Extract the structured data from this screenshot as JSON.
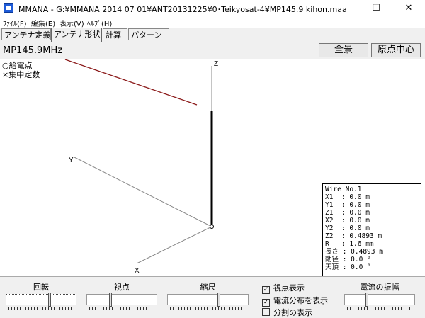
{
  "window": {
    "title": "MMANA - G:¥MMANA 2014 07 01¥ANT20131225¥0･Teikyosat-4¥MP145.9 kihon.maa",
    "minimize": "—",
    "maximize": "☐",
    "close": "✕"
  },
  "menu": [
    "ﾌｧｲﾙ(F)",
    "編集(E)",
    "表示(V)",
    "ﾍﾙﾌﾟ(H)"
  ],
  "tabs": [
    "アンテナ定義",
    "アンテナ形状",
    "計算",
    "パターン"
  ],
  "active_tab": 1,
  "top": {
    "model_name": "MP145.9MHz",
    "btn_full": "全景",
    "btn_center": "原点中心"
  },
  "legend": {
    "feed": "○給電点",
    "load": "×集中定数"
  },
  "axes": {
    "x": "X",
    "y": "Y",
    "z": "Z"
  },
  "wire_info": [
    "Wire No.1",
    "X1  : 0.0 m",
    "Y1  : 0.0 m",
    "Z1  : 0.0 m",
    "X2  : 0.0 m",
    "Y2  : 0.0 m",
    "Z2  : 0.4893 m",
    "R   : 1.6 mm",
    "長さ : 0.4893 m",
    "動径 : 0.0 °",
    "天頂 : 0.0 °"
  ],
  "controls": {
    "rotate": "回転",
    "viewpoint": "視点",
    "scale": "縮尺",
    "current_amp": "電流の振幅"
  },
  "checkboxes": [
    {
      "label": "視点表示",
      "checked": true
    },
    {
      "label": "電流分布を表示",
      "checked": true
    },
    {
      "label": "分割の表示",
      "checked": false
    }
  ]
}
